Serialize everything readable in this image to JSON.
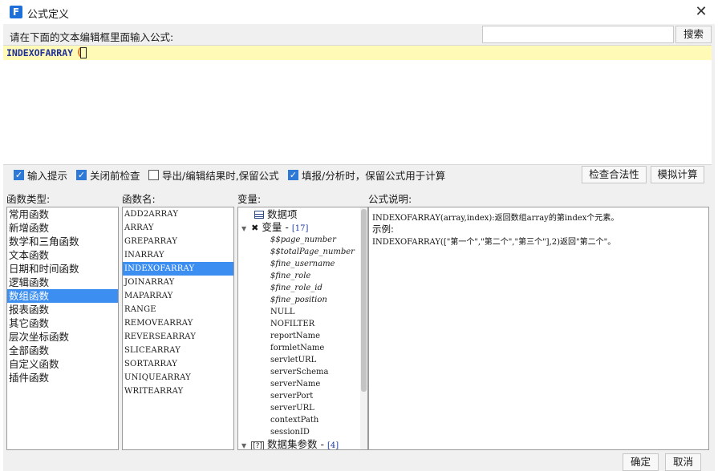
{
  "window": {
    "title": "公式定义",
    "logo": "F"
  },
  "search": {
    "prompt": "请在下面的文本编辑框里面输入公式:",
    "value": "",
    "button": "搜索"
  },
  "editor": {
    "function_name": "INDEXOFARRAY",
    "paren": "("
  },
  "options": [
    {
      "label": "输入提示",
      "checked": true
    },
    {
      "label": "关闭前检查",
      "checked": true
    },
    {
      "label": "导出/编辑结果时,保留公式",
      "checked": false
    },
    {
      "label": "填报/分析时，保留公式用于计算",
      "checked": true
    }
  ],
  "buttons": {
    "check_validity": "检查合法性",
    "simulate": "模拟计算",
    "ok": "确定",
    "cancel": "取消"
  },
  "columns": {
    "categories": "函数类型:",
    "functions": "函数名:",
    "variables": "变量:",
    "description": "公式说明:"
  },
  "categories": [
    "常用函数",
    "新增函数",
    "数学和三角函数",
    "文本函数",
    "日期和时间函数",
    "逻辑函数",
    "数组函数",
    "报表函数",
    "其它函数",
    "层次坐标函数",
    "全部函数",
    "自定义函数",
    "插件函数"
  ],
  "selected_category": "数组函数",
  "functions": [
    "ADD2ARRAY",
    "ARRAY",
    "GREPARRAY",
    "INARRAY",
    "INDEXOFARRAY",
    "JOINARRAY",
    "MAPARRAY",
    "RANGE",
    "REMOVEARRAY",
    "REVERSEARRAY",
    "SLICEARRAY",
    "SORTARRAY",
    "UNIQUEARRAY",
    "WRITEARRAY"
  ],
  "selected_function": "INDEXOFARRAY",
  "variables": {
    "data_item": "数据项",
    "variable_group": "变量 - ",
    "variable_count": "[17]",
    "items": [
      "$$page_number",
      "$$totalPage_number",
      "$fine_username",
      "$fine_role",
      "$fine_role_id",
      "$fine_position",
      "NULL",
      "NOFILTER",
      "reportName",
      "formletName",
      "servletURL",
      "serverSchema",
      "serverName",
      "serverPort",
      "serverURL",
      "contextPath",
      "sessionID"
    ],
    "dataset_group": "数据集参数 - ",
    "dataset_count": "[4]"
  },
  "description": {
    "signature": "INDEXOFARRAY(array,index):返回数组array的第index个元素。",
    "example_label": "示例:",
    "example": "INDEXOFARRAY([\"第一个\",\"第二个\",\"第三个\"],2)返回\"第二个\"。"
  }
}
